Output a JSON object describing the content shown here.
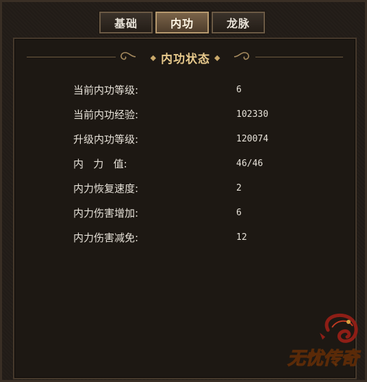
{
  "tabs": [
    {
      "label": "基础",
      "active": false
    },
    {
      "label": "内功",
      "active": true
    },
    {
      "label": "龙脉",
      "active": false
    }
  ],
  "section_title": "内功状态",
  "stats": [
    {
      "label": "当前内功等级:",
      "value": "6"
    },
    {
      "label": "当前内功经验:",
      "value": "102330"
    },
    {
      "label": "升级内功等级:",
      "value": "120074"
    },
    {
      "label": "内   力   值:",
      "value": "46/46"
    },
    {
      "label": "内力恢复速度:",
      "value": "2"
    },
    {
      "label": "内力伤害增加:",
      "value": "6"
    },
    {
      "label": "内力伤害减免:",
      "value": "12"
    }
  ],
  "logo": {
    "text": "无忧传奇"
  },
  "colors": {
    "title": "#e7c98c",
    "text": "#e6e1d8",
    "accent": "#b79a6f"
  }
}
